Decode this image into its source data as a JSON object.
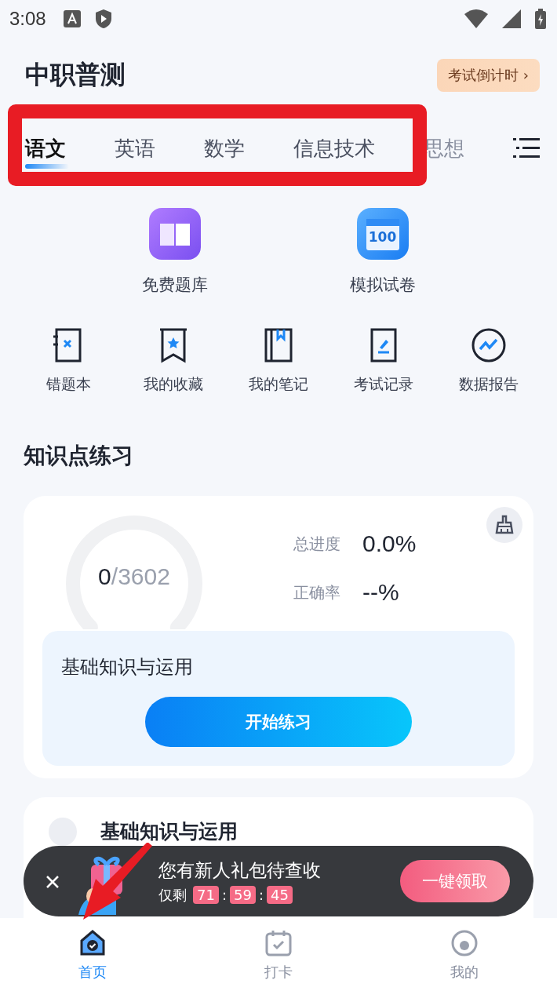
{
  "status_bar": {
    "time": "3:08"
  },
  "header": {
    "title": "中职普测",
    "countdown_button": "考试倒计时 ›"
  },
  "tabs": [
    {
      "label": "语文",
      "selected": true
    },
    {
      "label": "英语",
      "selected": false
    },
    {
      "label": "数学",
      "selected": false
    },
    {
      "label": "信息技术",
      "selected": false
    },
    {
      "label": "思想",
      "selected": false
    }
  ],
  "main_features": [
    {
      "label": "免费题库",
      "kind": "book"
    },
    {
      "label": "模拟试卷",
      "kind": "paper",
      "badge": "100"
    }
  ],
  "tools": [
    {
      "label": "错题本",
      "kind": "wrong"
    },
    {
      "label": "我的收藏",
      "kind": "favorite"
    },
    {
      "label": "我的笔记",
      "kind": "notes"
    },
    {
      "label": "考试记录",
      "kind": "record"
    },
    {
      "label": "数据报告",
      "kind": "report"
    }
  ],
  "section_title": "知识点练习",
  "practice_card": {
    "done": "0",
    "total": "/3602",
    "stats": [
      {
        "label": "总进度",
        "value": "0.0%"
      },
      {
        "label": "正确率",
        "value": "--%"
      }
    ],
    "topic": "基础知识与运用",
    "start_button": "开始练习"
  },
  "next_card": {
    "title": "基础知识与运用"
  },
  "gift_popup": {
    "message": "您有新人礼包待查收",
    "remaining_label": "仅剩",
    "timer": [
      "71",
      "59",
      "45"
    ],
    "separator": ":",
    "claim_button": "一键领取"
  },
  "bottom_nav": [
    {
      "label": "首页",
      "kind": "home",
      "selected": true
    },
    {
      "label": "打卡",
      "kind": "calendar",
      "selected": false
    },
    {
      "label": "我的",
      "kind": "profile",
      "selected": false
    }
  ]
}
